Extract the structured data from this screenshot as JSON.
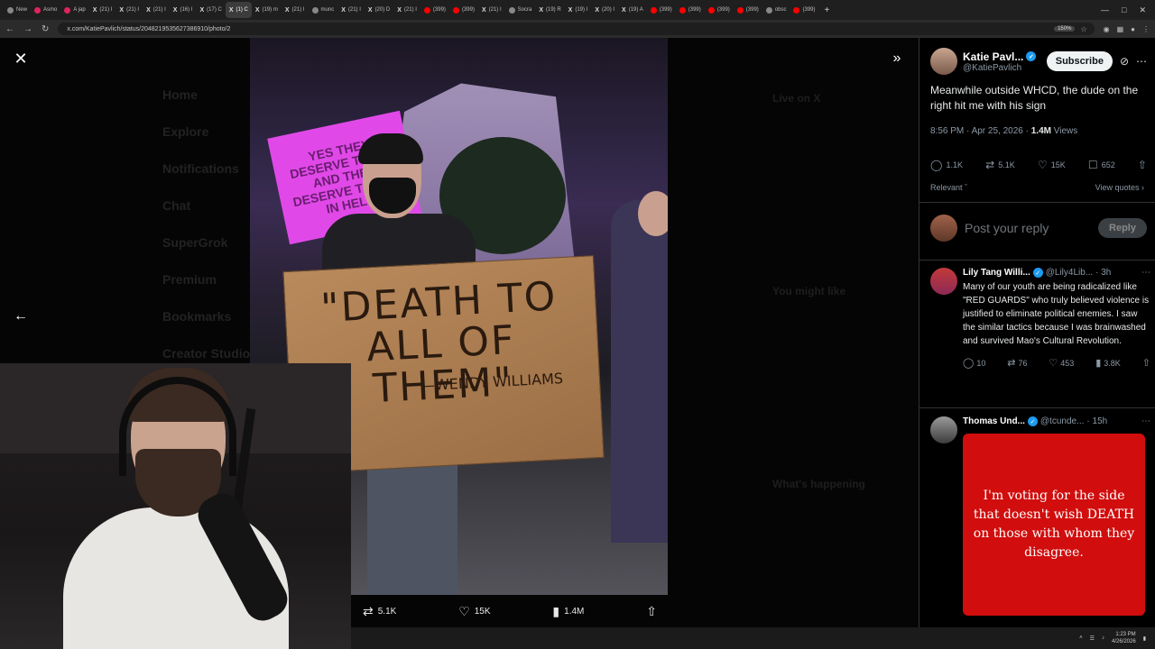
{
  "browser": {
    "tabs": [
      {
        "label": "New",
        "icon": "chrome"
      },
      {
        "label": "Asmo",
        "icon": "red"
      },
      {
        "label": "A jap",
        "icon": "red"
      },
      {
        "label": "(21) I",
        "icon": "x"
      },
      {
        "label": "(21) I",
        "icon": "x"
      },
      {
        "label": "(21) I",
        "icon": "x"
      },
      {
        "label": "(16) I",
        "icon": "x"
      },
      {
        "label": "(17) C",
        "icon": "x"
      },
      {
        "label": "(1) C",
        "icon": "x",
        "active": true
      },
      {
        "label": "(19) m",
        "icon": "x"
      },
      {
        "label": "(21) I",
        "icon": "x"
      },
      {
        "label": "munc",
        "icon": "chrome"
      },
      {
        "label": "(21) I",
        "icon": "x"
      },
      {
        "label": "(20) D",
        "icon": "x"
      },
      {
        "label": "(21) I",
        "icon": "x"
      },
      {
        "label": "(399)",
        "icon": "yt"
      },
      {
        "label": "(399)",
        "icon": "yt"
      },
      {
        "label": "(21) I",
        "icon": "x"
      },
      {
        "label": "Socra",
        "icon": "chrome"
      },
      {
        "label": "(19) R",
        "icon": "x"
      },
      {
        "label": "(19) I",
        "icon": "x"
      },
      {
        "label": "(20) I",
        "icon": "x"
      },
      {
        "label": "(19) A",
        "icon": "x"
      },
      {
        "label": "(399)",
        "icon": "yt"
      },
      {
        "label": "(399)",
        "icon": "yt"
      },
      {
        "label": "(399)",
        "icon": "yt"
      },
      {
        "label": "(399)",
        "icon": "yt"
      },
      {
        "label": "obsc",
        "icon": "chrome"
      },
      {
        "label": "(399)",
        "icon": "yt"
      }
    ],
    "url": "x.com/KatiePavlich/status/2048219535627386910/photo/2",
    "zoom": "150%"
  },
  "ghost": {
    "nav": [
      "Home",
      "Explore",
      "Notifications",
      "Chat",
      "SuperGrok",
      "Premium",
      "Bookmarks",
      "Creator Studio"
    ],
    "right": [
      "Live on X",
      "You might like",
      "What's happening"
    ]
  },
  "photo": {
    "sign_main": "\"DEATH TO ALL OF THEM\"",
    "sign_sub": "—WENDY WILLIAMS",
    "pink_sign": "YES THEY DESERVE TO DIE AND THEY DESERVE TO ROT IN HELL"
  },
  "media_actions": {
    "retweets": "5.1K",
    "likes": "15K",
    "views": "1.4M"
  },
  "tweet": {
    "name": "Katie Pavl...",
    "handle": "@KatiePavlich",
    "subscribe": "Subscribe",
    "text": "Meanwhile outside WHCD, the dude on the right hit me with his sign",
    "time": "8:56 PM · Apr 25, 2026 · ",
    "views_count": "1.4M",
    "views_label": " Views",
    "replies": "1.1K",
    "retweets": "5.1K",
    "likes": "15K",
    "bookmarks": "652",
    "sort": "Relevant",
    "view_quotes": "View quotes"
  },
  "reply": {
    "placeholder": "Post your reply",
    "button": "Reply"
  },
  "posts": [
    {
      "name": "Lily Tang Willi...",
      "handle": "@Lily4Lib...",
      "time": "· 3h",
      "text": "Many of our youth are being radicalized like \"RED GUARDS\" who truly believed violence is justified to eliminate political enemies. I saw the similar tactics because I was brainwashed and survived Mao's Cultural Revolution.",
      "replies": "10",
      "retweets": "76",
      "likes": "453",
      "views": "3.8K"
    },
    {
      "name": "Thomas Und...",
      "handle": "@tcunde...",
      "time": "· 15h",
      "card_text": "I'm voting for the side that doesn't wish DEATH on those with whom they disagree."
    }
  ],
  "taskbar": {
    "time": "1:23 PM",
    "date": "4/26/2026"
  },
  "colors": {
    "accent": "#1d9bf0",
    "card_red": "#d10d0d",
    "bg": "#000000"
  }
}
